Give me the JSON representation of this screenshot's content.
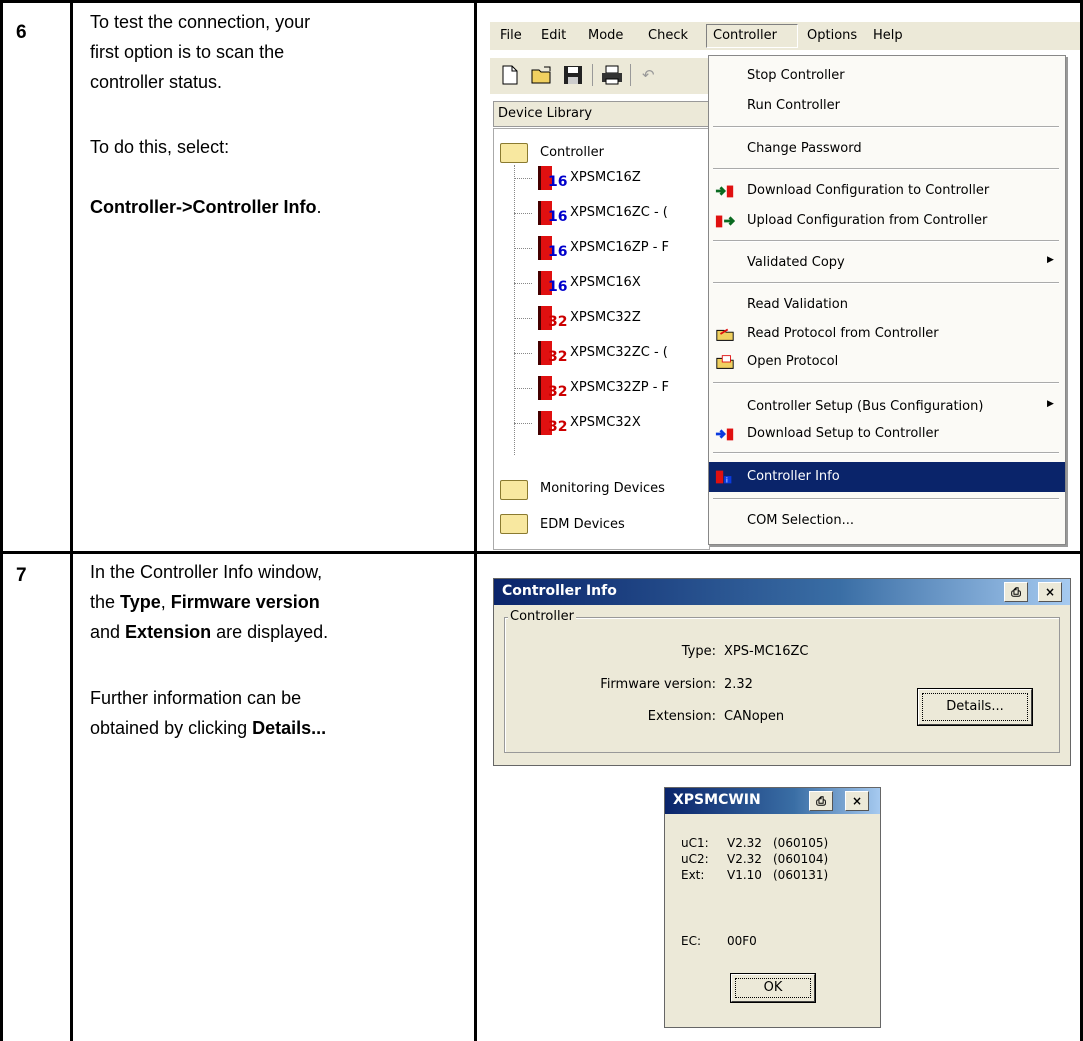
{
  "steps": [
    {
      "number": "6",
      "text": {
        "line1": "To test the connection, your",
        "line2": "first option is to scan the",
        "line3": "controller status.",
        "line4": "To do this, select:",
        "line5": "Controller->Controller Info",
        "line5_suffix": "."
      }
    },
    {
      "number": "7",
      "text": {
        "line1": "In the Controller Info window,",
        "line2_pre": "the ",
        "line2_b1": "Type",
        "line2_mid": ", ",
        "line2_b2": "Firmware version",
        "line3_pre": "and ",
        "line3_b": "Extension",
        "line3_post": " are displayed.",
        "line4": "Further information can be",
        "line5_pre": "obtained by clicking ",
        "line5_b": "Details..."
      }
    }
  ],
  "app": {
    "menubar": [
      "File",
      "Edit",
      "Mode",
      "Check",
      "Controller",
      "Options",
      "Help"
    ],
    "device_library_label": "Device Library",
    "tree": {
      "root": "Controller",
      "devices": [
        {
          "name": "XPSMC16Z",
          "badge": "16"
        },
        {
          "name": "XPSMC16ZC - (",
          "badge": "16"
        },
        {
          "name": "XPSMC16ZP - F",
          "badge": "16"
        },
        {
          "name": "XPSMC16X",
          "badge": "16"
        },
        {
          "name": "XPSMC32Z",
          "badge": "32"
        },
        {
          "name": "XPSMC32ZC - (",
          "badge": "32"
        },
        {
          "name": "XPSMC32ZP - F",
          "badge": "32"
        },
        {
          "name": "XPSMC32X",
          "badge": "32"
        }
      ],
      "other_folders": [
        "Monitoring Devices",
        "EDM Devices"
      ]
    },
    "controller_menu": {
      "stop": "Stop Controller",
      "run": "Run Controller",
      "change_password": "Change Password",
      "download_config": "Download Configuration to Controller",
      "upload_config": "Upload Configuration from Controller",
      "validated_copy": "Validated Copy",
      "read_validation": "Read Validation",
      "read_protocol": "Read Protocol from Controller",
      "open_protocol": "Open Protocol",
      "controller_setup": "Controller Setup (Bus Configuration)",
      "download_setup": "Download Setup to Controller",
      "controller_info": "Controller Info",
      "com_selection": "COM Selection..."
    }
  },
  "controller_info_dialog": {
    "title": "Controller Info",
    "group": "Controller",
    "type_label": "Type:",
    "type_value": "XPS-MC16ZC",
    "firmware_label": "Firmware version:",
    "firmware_value": "2.32",
    "extension_label": "Extension:",
    "extension_value": "CANopen",
    "details_button": "Details..."
  },
  "xpsmcwin_dialog": {
    "title": "XPSMCWIN",
    "rows": [
      {
        "label": "uC1:",
        "version": "V2.32",
        "date": "(060105)"
      },
      {
        "label": "uC2:",
        "version": "V2.32",
        "date": "(060104)"
      },
      {
        "label": "Ext:",
        "version": "V1.10",
        "date": "(060131)"
      }
    ],
    "ec_label": "EC:",
    "ec_value": "00F0",
    "ok_button": "OK"
  },
  "colors": {
    "titlebar": "#0a246a",
    "menu_highlight": "#0a246a",
    "badge_16": "#0000cc",
    "badge_32": "#cc0000",
    "device_block": "#e01010"
  }
}
